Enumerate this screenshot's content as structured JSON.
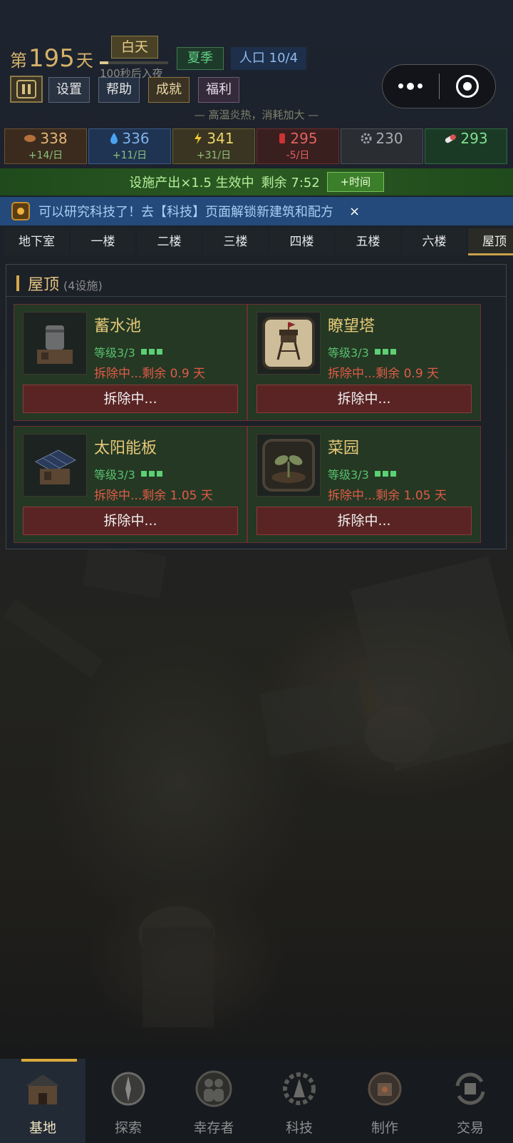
{
  "header": {
    "day_prefix": "第",
    "day_number": "195",
    "day_suffix": "天",
    "daylight_label": "白天",
    "daylight_progress": 0.12,
    "night_countdown": "100秒后入夜",
    "season_label": "夏季",
    "population_label": "人口 10/4",
    "buttons": {
      "settings": "设置",
      "help": "帮助",
      "achievements": "成就",
      "welfare": "福利"
    },
    "weather_note": "— 高温炎热，消耗加大 —"
  },
  "resources": [
    {
      "key": "food",
      "value": "338",
      "rate": "+14/日",
      "icon": "food-icon"
    },
    {
      "key": "water",
      "value": "336",
      "rate": "+11/日",
      "icon": "water-drop-icon"
    },
    {
      "key": "power",
      "value": "341",
      "rate": "+31/日",
      "icon": "lightning-icon"
    },
    {
      "key": "medicine",
      "value": "295",
      "rate": "-5/日",
      "icon": "medicine-icon"
    },
    {
      "key": "parts",
      "value": "230",
      "rate": "",
      "icon": "gear-icon"
    },
    {
      "key": "ammo",
      "value": "293",
      "rate": "",
      "icon": "pill-icon"
    }
  ],
  "boost": {
    "text": "设施产出×1.5 生效中",
    "remaining": "剩余 7:52",
    "add_time_label": "+时间"
  },
  "notice": {
    "text": "可以研究科技了！去【科技】页面解锁新建筑和配方",
    "close": "×"
  },
  "floor_tabs": [
    {
      "label": "地下室",
      "active": false
    },
    {
      "label": "一楼",
      "active": false
    },
    {
      "label": "二楼",
      "active": false
    },
    {
      "label": "三楼",
      "active": false
    },
    {
      "label": "四楼",
      "active": false
    },
    {
      "label": "五楼",
      "active": false
    },
    {
      "label": "六楼",
      "active": false
    },
    {
      "label": "屋顶",
      "active": true
    }
  ],
  "panel": {
    "title": "屋顶",
    "count": "(4设施)",
    "facilities": [
      {
        "name": "蓄水池",
        "level": "等级3/3",
        "status": "拆除中...剩余 0.9 天",
        "action": "拆除中...",
        "icon": "water-tower-icon"
      },
      {
        "name": "瞭望塔",
        "level": "等级3/3",
        "status": "拆除中...剩余 0.9 天",
        "action": "拆除中...",
        "icon": "watchtower-icon"
      },
      {
        "name": "太阳能板",
        "level": "等级3/3",
        "status": "拆除中...剩余 1.05 天",
        "action": "拆除中...",
        "icon": "solar-panel-icon"
      },
      {
        "name": "菜园",
        "level": "等级3/3",
        "status": "拆除中...剩余 1.05 天",
        "action": "拆除中...",
        "icon": "sprout-icon"
      }
    ]
  },
  "bottom_nav": [
    {
      "label": "基地",
      "active": true,
      "icon": "base-icon"
    },
    {
      "label": "探索",
      "active": false,
      "icon": "compass-icon"
    },
    {
      "label": "幸存者",
      "active": false,
      "icon": "survivors-icon"
    },
    {
      "label": "科技",
      "active": false,
      "icon": "tech-gear-icon"
    },
    {
      "label": "制作",
      "active": false,
      "icon": "crafting-icon"
    },
    {
      "label": "交易",
      "active": false,
      "icon": "trade-icon"
    }
  ],
  "colors": {
    "accent_gold": "#d4b16a",
    "danger": "#e05a46",
    "success": "#57c16d"
  }
}
